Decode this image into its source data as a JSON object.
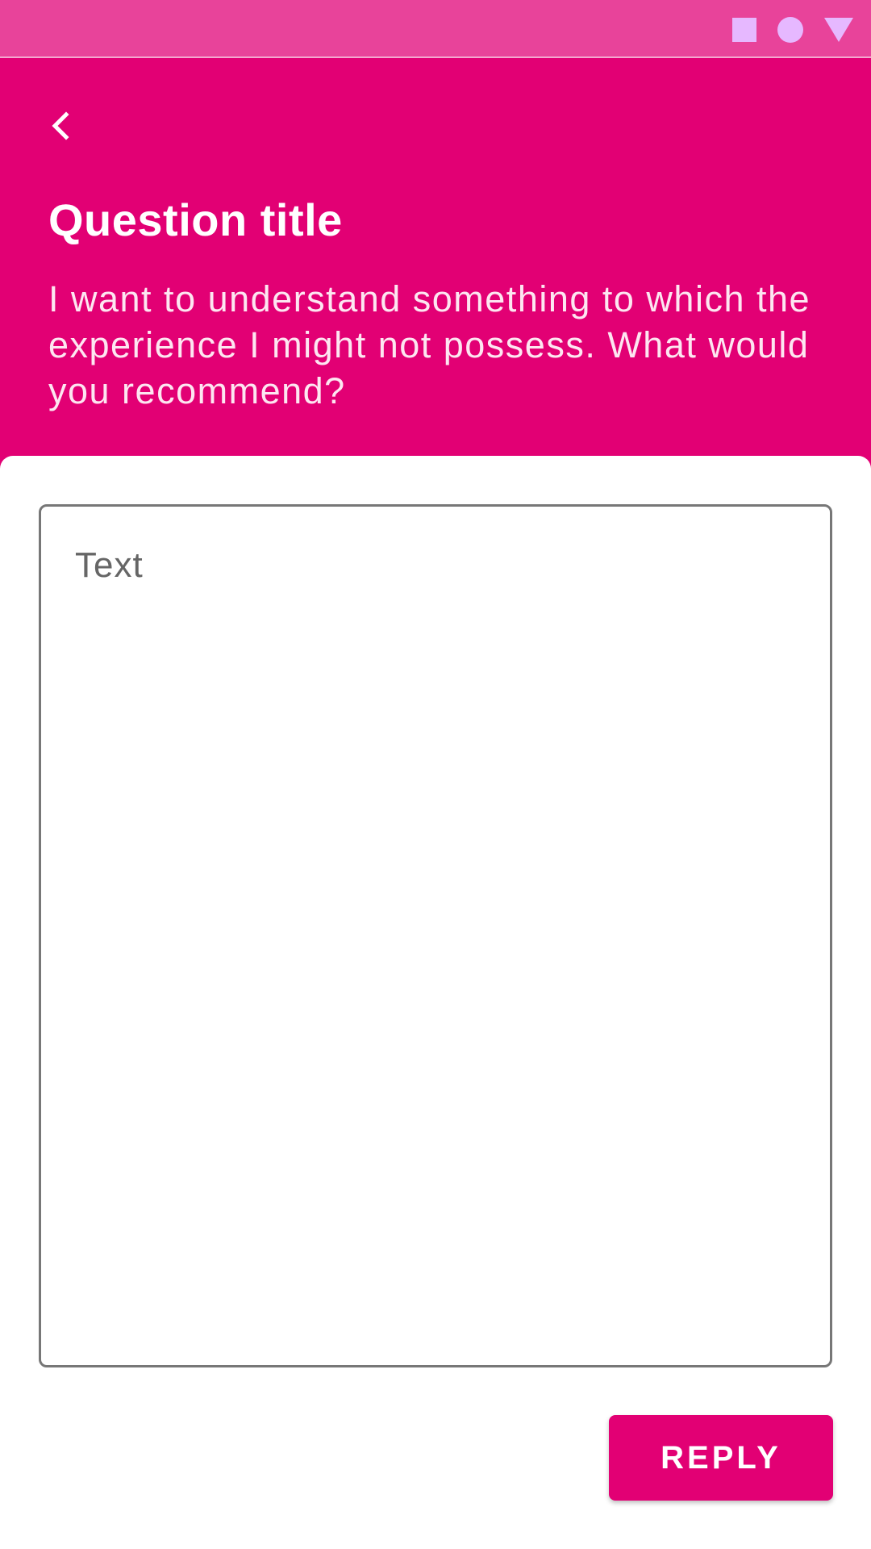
{
  "status_bar": {
    "icons": [
      "square-icon",
      "circle-icon",
      "triangle-icon"
    ],
    "icon_color": "#e6b8ff",
    "background": "#e8439a"
  },
  "header": {
    "back_icon": "chevron-left-icon",
    "title": "Question title",
    "description": "I want to understand something to which the experience I might not possess. What would you recommend?",
    "background": "#e20074"
  },
  "reply_form": {
    "text_placeholder": "Text",
    "reply_label": "REPLY"
  },
  "colors": {
    "accent": "#e20074",
    "surface": "#ffffff",
    "outline": "#777777"
  }
}
